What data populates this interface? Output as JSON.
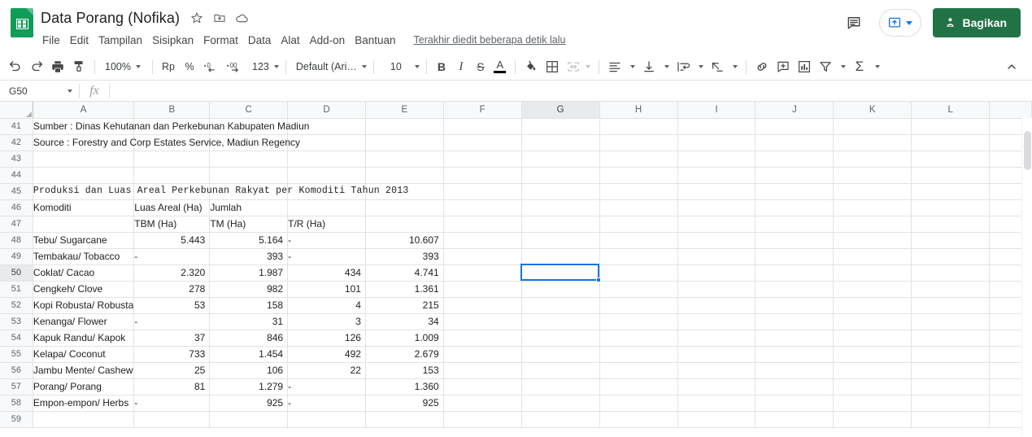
{
  "titlebar": {
    "doc_title": "Data Porang (Nofika)",
    "icons": [
      {
        "name": "star-icon",
        "label": "star"
      },
      {
        "name": "move-to-folder-icon",
        "label": "move to folder"
      },
      {
        "name": "cloud-saved-icon",
        "label": "saved to Drive"
      }
    ],
    "menus": [
      "File",
      "Edit",
      "Tampilan",
      "Sisipkan",
      "Format",
      "Data",
      "Alat",
      "Add-on",
      "Bantuan"
    ],
    "last_edit": "Terakhir diedit beberapa detik lalu",
    "comment_label": "comment-icon",
    "present_label": "present-icon",
    "share_label": "Bagikan",
    "share_color": "#217346",
    "accent_color": "#1a73e8"
  },
  "toolbar": {
    "undo": "undo-icon",
    "redo": "redo-icon",
    "print": "print-icon",
    "paint_format": "paint-format-icon",
    "zoom": "100%",
    "currency": "Rp",
    "percent": "%",
    "decrease_decimal": ".0",
    "increase_decimal": ".00",
    "number_format": "123",
    "font": "Default (Ari…",
    "font_size": "10",
    "bold": "B",
    "italic": "I",
    "strikethrough": "S",
    "text_color": "A",
    "fill_color": "fill-color-icon",
    "borders": "borders-icon",
    "merge_cells": "merge-cells-icon",
    "horizontal_align": "horizontal-align-icon",
    "vertical_align": "vertical-align-icon",
    "text_wrap": "text-wrap-icon",
    "text_rotation": "text-rotation-icon",
    "insert_link": "link-icon",
    "insert_comment": "insert-comment-icon",
    "insert_chart": "insert-chart-icon",
    "filter": "filter-icon",
    "functions": "sigma-icon",
    "collapse": "chevron-up-icon"
  },
  "formulabar": {
    "name_box": "G50",
    "fx": "fx",
    "formula_value": "",
    "formula_placeholder": ""
  },
  "grid": {
    "columns": [
      "A",
      "B",
      "C",
      "D",
      "E",
      "F",
      "G",
      "H",
      "I",
      "J",
      "K",
      "L",
      ""
    ],
    "selected_column": "G",
    "selected_row": "50",
    "selected_cell": "G50",
    "rows": [
      {
        "n": "41",
        "cells": [
          {
            "v": "Sumber : Dinas Kehutanan dan Perkebunan Kabupaten Madiun",
            "span": 4,
            "align": "left"
          },
          {
            "v": ""
          },
          {
            "v": ""
          },
          {
            "v": ""
          },
          {
            "v": ""
          },
          {
            "v": ""
          },
          {
            "v": ""
          },
          {
            "v": ""
          },
          {
            "v": ""
          },
          {
            "v": ""
          }
        ]
      },
      {
        "n": "42",
        "cells": [
          {
            "v": "Source : Forestry and Corp Estates Service, Madiun Regency",
            "span": 4,
            "align": "left"
          },
          {
            "v": ""
          },
          {
            "v": ""
          },
          {
            "v": ""
          },
          {
            "v": ""
          },
          {
            "v": ""
          },
          {
            "v": ""
          },
          {
            "v": ""
          },
          {
            "v": ""
          },
          {
            "v": ""
          }
        ]
      },
      {
        "n": "43",
        "cells": [
          {
            "v": ""
          },
          {
            "v": ""
          },
          {
            "v": ""
          },
          {
            "v": ""
          },
          {
            "v": ""
          },
          {
            "v": ""
          },
          {
            "v": ""
          },
          {
            "v": ""
          },
          {
            "v": ""
          },
          {
            "v": ""
          },
          {
            "v": ""
          },
          {
            "v": ""
          },
          {
            "v": ""
          }
        ]
      },
      {
        "n": "44",
        "cells": [
          {
            "v": ""
          },
          {
            "v": ""
          },
          {
            "v": ""
          },
          {
            "v": ""
          },
          {
            "v": ""
          },
          {
            "v": ""
          },
          {
            "v": ""
          },
          {
            "v": ""
          },
          {
            "v": ""
          },
          {
            "v": ""
          },
          {
            "v": ""
          },
          {
            "v": ""
          },
          {
            "v": ""
          }
        ]
      },
      {
        "n": "45",
        "cells": [
          {
            "v": "Produksi dan Luas Areal Perkebunan Rakyat per Komoditi Tahun 2013",
            "span": 5,
            "align": "left",
            "mono": true
          },
          {
            "v": ""
          },
          {
            "v": ""
          },
          {
            "v": ""
          },
          {
            "v": ""
          },
          {
            "v": ""
          },
          {
            "v": ""
          },
          {
            "v": ""
          },
          {
            "v": ""
          }
        ]
      },
      {
        "n": "46",
        "cells": [
          {
            "v": "Komoditi"
          },
          {
            "v": "Luas Areal (Ha)",
            "span": 3
          },
          {
            "v": "Jumlah"
          },
          {
            "v": ""
          },
          {
            "v": ""
          },
          {
            "v": ""
          },
          {
            "v": ""
          },
          {
            "v": ""
          },
          {
            "v": ""
          },
          {
            "v": ""
          },
          {
            "v": ""
          }
        ]
      },
      {
        "n": "47",
        "cells": [
          {
            "v": ""
          },
          {
            "v": "TBM (Ha)"
          },
          {
            "v": "TM (Ha)"
          },
          {
            "v": "T/R (Ha)"
          },
          {
            "v": ""
          },
          {
            "v": ""
          },
          {
            "v": ""
          },
          {
            "v": ""
          },
          {
            "v": ""
          },
          {
            "v": ""
          },
          {
            "v": ""
          },
          {
            "v": ""
          },
          {
            "v": ""
          }
        ]
      },
      {
        "n": "48",
        "cells": [
          {
            "v": "Tebu/ Sugarcane",
            "clip": true
          },
          {
            "v": "5.443",
            "num": true
          },
          {
            "v": "5.164",
            "num": true
          },
          {
            "v": "-"
          },
          {
            "v": "10.607",
            "num": true
          },
          {
            "v": ""
          },
          {
            "v": ""
          },
          {
            "v": ""
          },
          {
            "v": ""
          },
          {
            "v": ""
          },
          {
            "v": ""
          },
          {
            "v": ""
          },
          {
            "v": ""
          }
        ]
      },
      {
        "n": "49",
        "cells": [
          {
            "v": "Tembakau/ Tobacco",
            "clip": true
          },
          {
            "v": "-"
          },
          {
            "v": "393",
            "num": true
          },
          {
            "v": "-"
          },
          {
            "v": "393",
            "num": true
          },
          {
            "v": ""
          },
          {
            "v": ""
          },
          {
            "v": ""
          },
          {
            "v": ""
          },
          {
            "v": ""
          },
          {
            "v": ""
          },
          {
            "v": ""
          },
          {
            "v": ""
          }
        ]
      },
      {
        "n": "50",
        "cells": [
          {
            "v": "Coklat/ Cacao"
          },
          {
            "v": "2.320",
            "num": true
          },
          {
            "v": "1.987",
            "num": true
          },
          {
            "v": "434",
            "num": true
          },
          {
            "v": "4.741",
            "num": true
          },
          {
            "v": ""
          },
          {
            "v": ""
          },
          {
            "v": ""
          },
          {
            "v": ""
          },
          {
            "v": ""
          },
          {
            "v": ""
          },
          {
            "v": ""
          },
          {
            "v": ""
          }
        ]
      },
      {
        "n": "51",
        "cells": [
          {
            "v": "Cengkeh/ Clove"
          },
          {
            "v": "278",
            "num": true
          },
          {
            "v": "982",
            "num": true
          },
          {
            "v": "101",
            "num": true
          },
          {
            "v": "1.361",
            "num": true
          },
          {
            "v": ""
          },
          {
            "v": ""
          },
          {
            "v": ""
          },
          {
            "v": ""
          },
          {
            "v": ""
          },
          {
            "v": ""
          },
          {
            "v": ""
          },
          {
            "v": ""
          }
        ]
      },
      {
        "n": "52",
        "cells": [
          {
            "v": "Kopi Robusta/ Robusta",
            "clip": true
          },
          {
            "v": "53",
            "num": true
          },
          {
            "v": "158",
            "num": true
          },
          {
            "v": "4",
            "num": true
          },
          {
            "v": "215",
            "num": true
          },
          {
            "v": ""
          },
          {
            "v": ""
          },
          {
            "v": ""
          },
          {
            "v": ""
          },
          {
            "v": ""
          },
          {
            "v": ""
          },
          {
            "v": ""
          },
          {
            "v": ""
          }
        ]
      },
      {
        "n": "53",
        "cells": [
          {
            "v": "Kenanga/ Flower",
            "clip": true
          },
          {
            "v": "-"
          },
          {
            "v": "31",
            "num": true
          },
          {
            "v": "3",
            "num": true
          },
          {
            "v": "34",
            "num": true
          },
          {
            "v": ""
          },
          {
            "v": ""
          },
          {
            "v": ""
          },
          {
            "v": ""
          },
          {
            "v": ""
          },
          {
            "v": ""
          },
          {
            "v": ""
          },
          {
            "v": ""
          }
        ]
      },
      {
        "n": "54",
        "cells": [
          {
            "v": "Kapuk Randu/ Kapok",
            "clip": true
          },
          {
            "v": "37",
            "num": true
          },
          {
            "v": "846",
            "num": true
          },
          {
            "v": "126",
            "num": true
          },
          {
            "v": "1.009",
            "num": true
          },
          {
            "v": ""
          },
          {
            "v": ""
          },
          {
            "v": ""
          },
          {
            "v": ""
          },
          {
            "v": ""
          },
          {
            "v": ""
          },
          {
            "v": ""
          },
          {
            "v": ""
          }
        ]
      },
      {
        "n": "55",
        "cells": [
          {
            "v": "Kelapa/ Coconut",
            "clip": true
          },
          {
            "v": "733",
            "num": true
          },
          {
            "v": "1.454",
            "num": true
          },
          {
            "v": "492",
            "num": true
          },
          {
            "v": "2.679",
            "num": true
          },
          {
            "v": ""
          },
          {
            "v": ""
          },
          {
            "v": ""
          },
          {
            "v": ""
          },
          {
            "v": ""
          },
          {
            "v": ""
          },
          {
            "v": ""
          },
          {
            "v": ""
          }
        ]
      },
      {
        "n": "56",
        "cells": [
          {
            "v": "Jambu Mente/ Cashew",
            "clip": true
          },
          {
            "v": "25",
            "num": true
          },
          {
            "v": "106",
            "num": true
          },
          {
            "v": "22",
            "num": true
          },
          {
            "v": "153",
            "num": true
          },
          {
            "v": ""
          },
          {
            "v": ""
          },
          {
            "v": ""
          },
          {
            "v": ""
          },
          {
            "v": ""
          },
          {
            "v": ""
          },
          {
            "v": ""
          },
          {
            "v": ""
          }
        ]
      },
      {
        "n": "57",
        "cells": [
          {
            "v": "Porang/ Porang"
          },
          {
            "v": "81",
            "num": true
          },
          {
            "v": "1.279",
            "num": true
          },
          {
            "v": "-"
          },
          {
            "v": "1.360",
            "num": true
          },
          {
            "v": ""
          },
          {
            "v": ""
          },
          {
            "v": ""
          },
          {
            "v": ""
          },
          {
            "v": ""
          },
          {
            "v": ""
          },
          {
            "v": ""
          },
          {
            "v": ""
          }
        ]
      },
      {
        "n": "58",
        "cells": [
          {
            "v": "Empon-empon/ Herbs",
            "clip": true
          },
          {
            "v": "-"
          },
          {
            "v": "925",
            "num": true
          },
          {
            "v": "-"
          },
          {
            "v": "925",
            "num": true
          },
          {
            "v": ""
          },
          {
            "v": ""
          },
          {
            "v": ""
          },
          {
            "v": ""
          },
          {
            "v": ""
          },
          {
            "v": ""
          },
          {
            "v": ""
          },
          {
            "v": ""
          }
        ]
      },
      {
        "n": "59",
        "cells": [
          {
            "v": ""
          },
          {
            "v": ""
          },
          {
            "v": ""
          },
          {
            "v": ""
          },
          {
            "v": ""
          },
          {
            "v": ""
          },
          {
            "v": ""
          },
          {
            "v": ""
          },
          {
            "v": ""
          },
          {
            "v": ""
          },
          {
            "v": ""
          },
          {
            "v": ""
          },
          {
            "v": ""
          }
        ]
      }
    ]
  }
}
